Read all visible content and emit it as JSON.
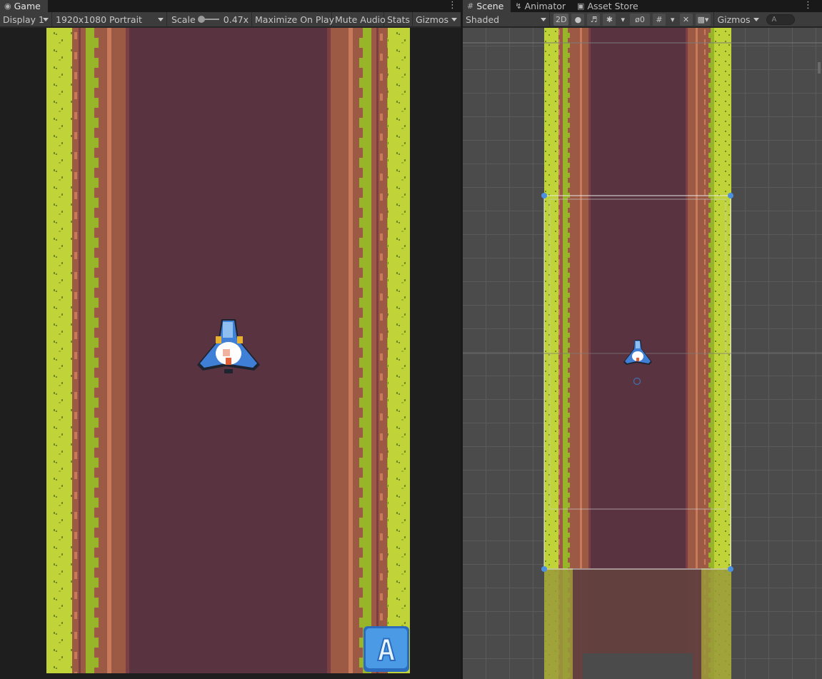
{
  "game": {
    "tab_label": "Game",
    "toolbar": {
      "display": "Display 1",
      "resolution": "1920x1080 Portrait",
      "scale_label": "Scale",
      "scale_value": "0.47x",
      "maximize": "Maximize On Play",
      "mute": "Mute Audio",
      "stats": "Stats",
      "gizmos": "Gizmos"
    },
    "action_button_letter": "A"
  },
  "scene": {
    "tabs": [
      {
        "label": "Scene",
        "icon": "grid-icon"
      },
      {
        "label": "Animator",
        "icon": "animator-icon"
      },
      {
        "label": "Asset Store",
        "icon": "store-icon"
      }
    ],
    "toolbar": {
      "shading": "Shaded",
      "mode_2d": "2D",
      "hidden_count": "0",
      "gizmos": "Gizmos",
      "search_placeholder": "A"
    }
  },
  "colors": {
    "road": "#5a3340",
    "road_edge": "#7a3e44",
    "dirt": "#9c5a45",
    "dirt_light": "#c97a5a",
    "grass": "#c0d43a",
    "grass_dark": "#98b52a",
    "ship_blue": "#3f7fd6",
    "ship_light": "#8fbff0",
    "button_blue": "#4a9ae6"
  }
}
